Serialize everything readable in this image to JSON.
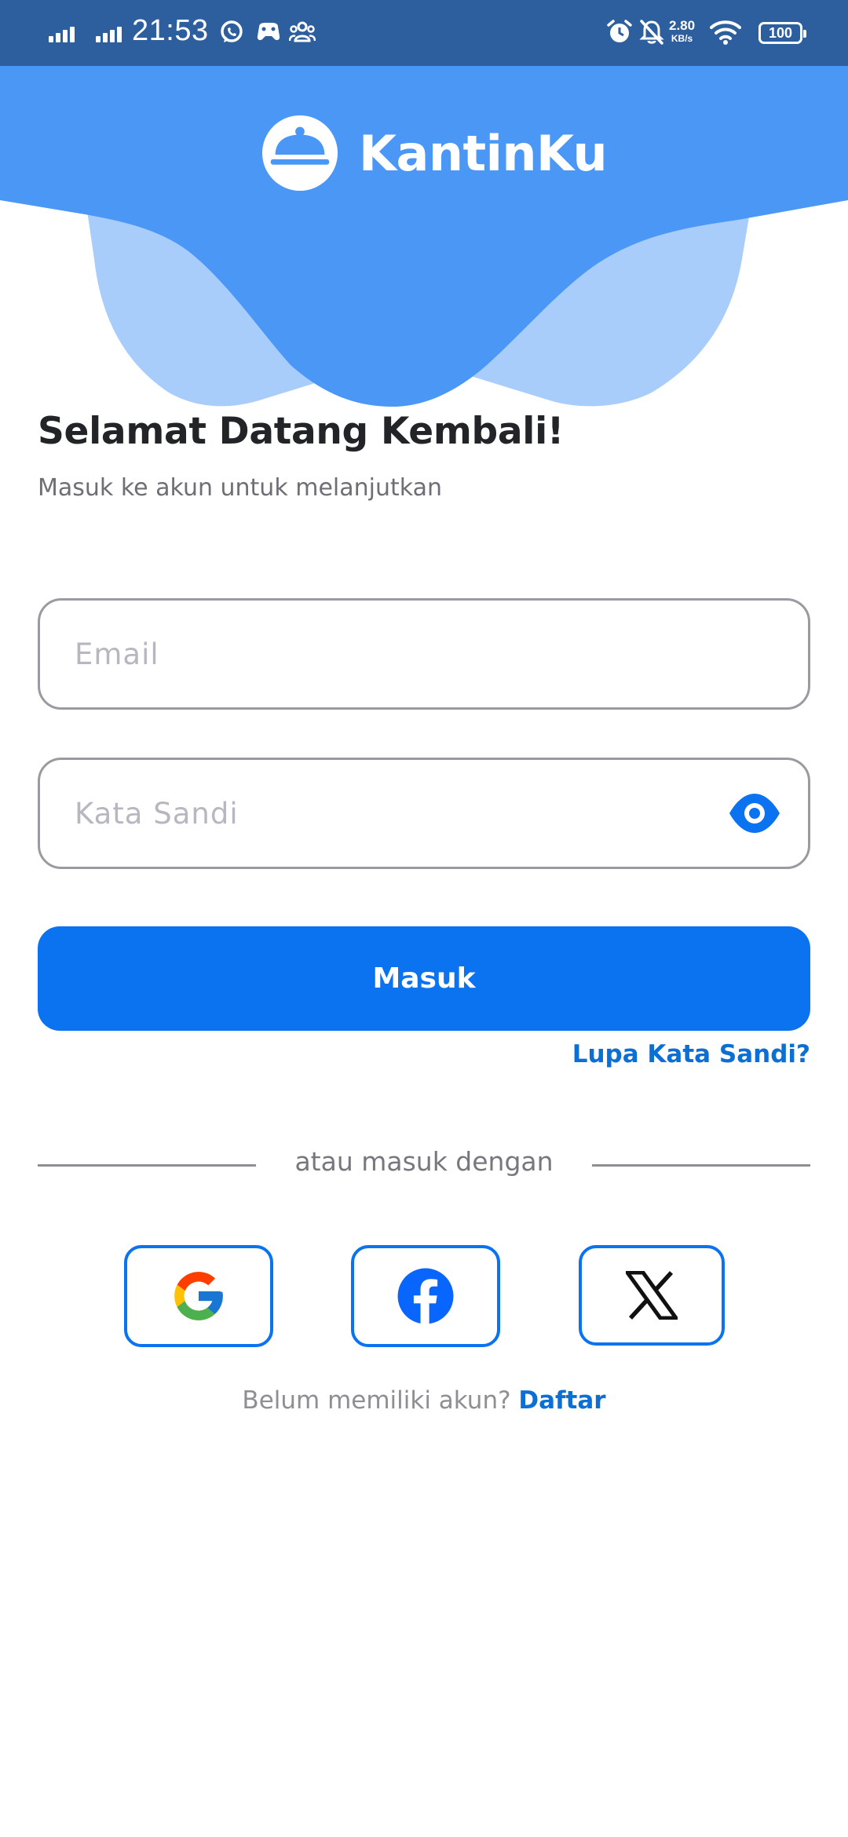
{
  "status_bar": {
    "time": "21:53",
    "net_speed_value": "2.80",
    "net_speed_unit": "KB/s",
    "battery": "100",
    "icons": [
      "signal-icon",
      "signal-icon",
      "whatsapp-icon",
      "game-icon",
      "group-icon",
      "alarm-icon",
      "bell-muted-icon",
      "wifi-icon",
      "battery-icon"
    ]
  },
  "header": {
    "app_name": "KantinKu",
    "logo_icon": "cloche-icon"
  },
  "welcome": {
    "title": "Selamat Datang Kembali!",
    "subtitle": "Masuk ke akun untuk melanjutkan"
  },
  "form": {
    "email_placeholder": "Email",
    "email_value": "",
    "password_placeholder": "Kata Sandi",
    "password_value": "",
    "password_toggle_icon": "eye-icon",
    "login_label": "Masuk",
    "forgot_label": "Lupa Kata Sandi?"
  },
  "social": {
    "divider_label": "atau masuk dengan",
    "providers": [
      "google-icon",
      "facebook-icon",
      "x-icon"
    ]
  },
  "signup": {
    "prompt": "Belum memiliki akun?",
    "link_label": "Daftar"
  },
  "colors": {
    "primary": "#0b72f0",
    "link": "#0b6fd6",
    "status_bar": "#2d5e9e",
    "header_blue": "#4a97f5",
    "header_light": "#a8cdfb"
  }
}
